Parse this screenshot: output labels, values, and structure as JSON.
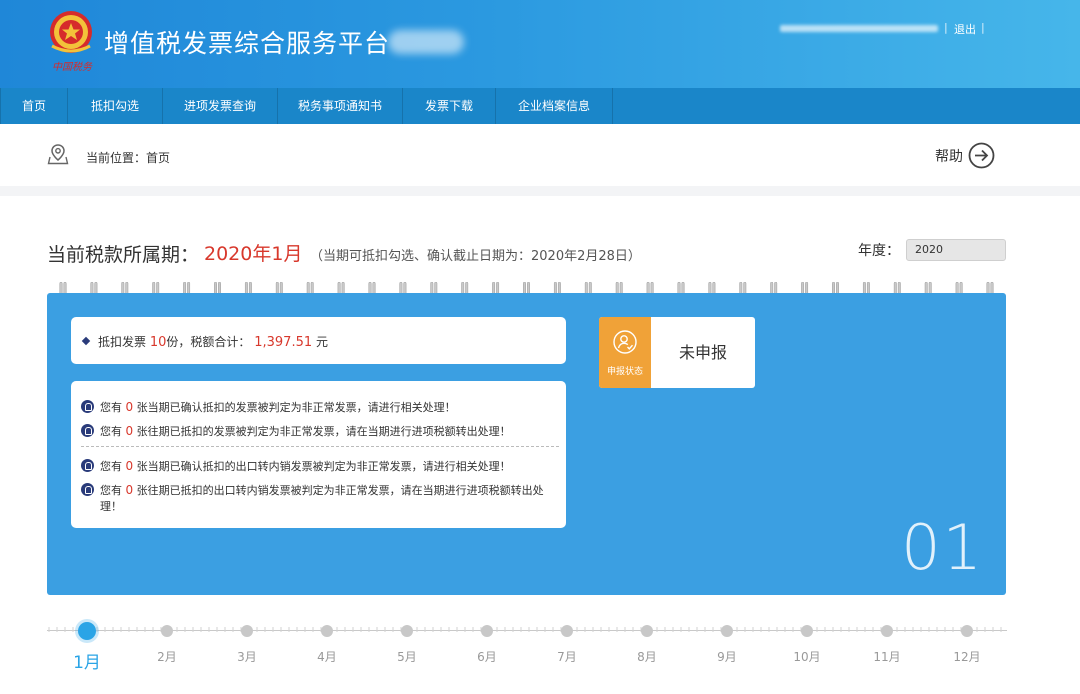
{
  "header": {
    "site_title": "增值税发票综合服务平台",
    "separator": "|",
    "logout_label": "退出",
    "emblem_text": "中国税务"
  },
  "nav": {
    "items": [
      {
        "label": "首页"
      },
      {
        "label": "抵扣勾选"
      },
      {
        "label": "进项发票查询"
      },
      {
        "label": "税务事项通知书"
      },
      {
        "label": "发票下载"
      },
      {
        "label": "企业档案信息"
      }
    ]
  },
  "breadcrumb": {
    "text": "当前位置：首页",
    "help_label": "帮助"
  },
  "period": {
    "label": "当前税款所属期：",
    "value": "2020年1月",
    "note": "（当期可抵扣勾选、确认截止日期为：2020年2月28日）",
    "year_label": "年度：",
    "year_value": "2020"
  },
  "summary": {
    "prefix": "抵扣发票",
    "count": "10",
    "mid": "份，税额合计：",
    "amount": "1,397.51",
    "suffix": "元"
  },
  "alerts": [
    {
      "pre": "您有",
      "count": "0",
      "post": "张当期已确认抵扣的发票被判定为非正常发票，请进行相关处理！"
    },
    {
      "pre": "您有",
      "count": "0",
      "post": "张往期已抵扣的发票被判定为非正常发票，请在当期进行进项税额转出处理！"
    },
    {
      "pre": "您有",
      "count": "0",
      "post": "张当期已确认抵扣的出口转内销发票被判定为非正常发票，请进行相关处理！"
    },
    {
      "pre": "您有",
      "count": "0",
      "post": "张往期已抵扣的出口转内销发票被判定为非正常发票，请在当期进行进项税额转出处理！"
    }
  ],
  "status": {
    "tag_label": "申报状态",
    "value": "未申报"
  },
  "calendar": {
    "month_number": "01"
  },
  "timeline": {
    "active_index": 0,
    "months": [
      "1月",
      "2月",
      "3月",
      "4月",
      "5月",
      "6月",
      "7月",
      "8月",
      "9月",
      "10月",
      "11月",
      "12月"
    ]
  },
  "colors": {
    "header_blue": "#1f87d8",
    "nav_blue": "#1a86c9",
    "card_blue": "#3b9fe2",
    "accent_red": "#d8382c",
    "status_orange": "#f0a238",
    "timeline_active": "#2aa4e6"
  },
  "icons": {
    "emblem": "tax-emblem-icon",
    "breadcrumb": "location-pin-icon",
    "help": "arrow-right-circle-icon",
    "status": "user-check-icon",
    "alert": "bell-icon",
    "summary": "diamond-bullet-icon"
  }
}
